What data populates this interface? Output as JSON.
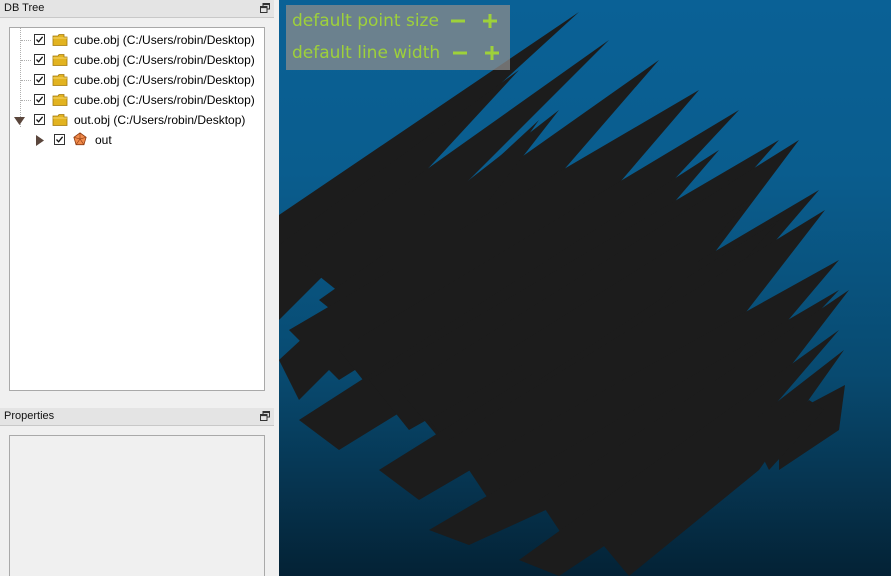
{
  "db_tree": {
    "title": "DB Tree",
    "items": [
      {
        "label": "cube.obj (C:/Users/robin/Desktop)",
        "checked": true,
        "icon": "folder-icon"
      },
      {
        "label": "cube.obj (C:/Users/robin/Desktop)",
        "checked": true,
        "icon": "folder-icon"
      },
      {
        "label": "cube.obj (C:/Users/robin/Desktop)",
        "checked": true,
        "icon": "folder-icon"
      },
      {
        "label": "cube.obj (C:/Users/robin/Desktop)",
        "checked": true,
        "icon": "folder-icon"
      },
      {
        "label": "out.obj (C:/Users/robin/Desktop)",
        "checked": true,
        "icon": "folder-icon",
        "expanded": true
      },
      {
        "label": "out",
        "checked": true,
        "icon": "mesh-icon",
        "expanded": false
      }
    ]
  },
  "properties": {
    "title": "Properties"
  },
  "viewer": {
    "overlay": {
      "point_size_label": "default point size",
      "line_width_label": "default line width"
    },
    "colors": {
      "overlay_text": "#9ed13a",
      "background_top": "#0a6196",
      "background_bottom": "#042235",
      "mesh": "#1c1c1c"
    }
  }
}
